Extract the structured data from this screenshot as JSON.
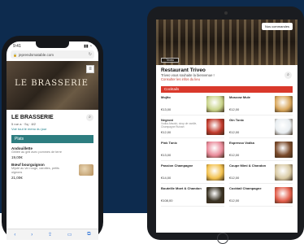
{
  "phone": {
    "status_time": "9:41",
    "status_icons": "▮▮ ◔",
    "url": "jeprendsmatable.com",
    "restaurant_name": "LE BRASSERIE",
    "hero_sign": "LE BRASSERIE",
    "subtitle": "5 rue a · Sq · 8/2",
    "link_text": "Voir tout le menu du jour",
    "category": "Plats",
    "items": [
      {
        "name": "Andouillette",
        "desc": "Grillée au grill avec pommes de terre",
        "price": "19,00€"
      },
      {
        "name": "Bœuf bourguignon",
        "desc": "Mijoté au vin rouge, carottes, petits oignons",
        "price": "21,00€"
      }
    ],
    "bottom_icons": [
      "‹",
      "›",
      "⇪",
      "▭",
      "⧉"
    ]
  },
  "tablet": {
    "links_button": "Nos commandes",
    "hero_logo": "Triveo",
    "name": "Restaurant Triveo",
    "tagline": "Triveo vous souhaite la bienvenue !",
    "link": "Consulter les infos du lieu",
    "category": "Cocktails",
    "items": [
      {
        "name": "Mojito",
        "desc": "",
        "price": "€13,00",
        "thumb_color": "#c9d48a"
      },
      {
        "name": "Moscow Mule",
        "desc": "",
        "price": "€12,00",
        "thumb_color": "#d9a75c"
      },
      {
        "name": "Negroni",
        "desc": "Vodka Absolut, sirop de vanille, Champagne Ruinart",
        "price": "€12,00",
        "thumb_color": "#c0392b"
      },
      {
        "name": "Gin Tonic",
        "desc": "",
        "price": "€12,00",
        "thumb_color": "#e8edf0"
      },
      {
        "name": "Pink Tonic",
        "desc": "",
        "price": "€13,00",
        "thumb_color": "#e98a9a"
      },
      {
        "name": "Espresso Vodka",
        "desc": "",
        "price": "€12,00",
        "thumb_color": "#7a4a2a"
      },
      {
        "name": "Passion Champagne",
        "desc": "",
        "price": "€14,00",
        "thumb_color": "#f2c14e"
      },
      {
        "name": "Coupe Mimi & Chandon",
        "desc": "",
        "price": "€12,00",
        "thumb_color": "#d8c9a3"
      },
      {
        "name": "Bouteille Moet & Chandon",
        "desc": "",
        "price": "€108,00",
        "thumb_color": "#3a3324"
      },
      {
        "name": "Cocktail Champagne",
        "desc": "",
        "price": "€12,00",
        "thumb_color": "#e25d4a"
      }
    ]
  },
  "colors": {
    "navy_background": "#0d2b4e",
    "phone_category": "#2d7d80",
    "tablet_category": "#d9382b"
  }
}
